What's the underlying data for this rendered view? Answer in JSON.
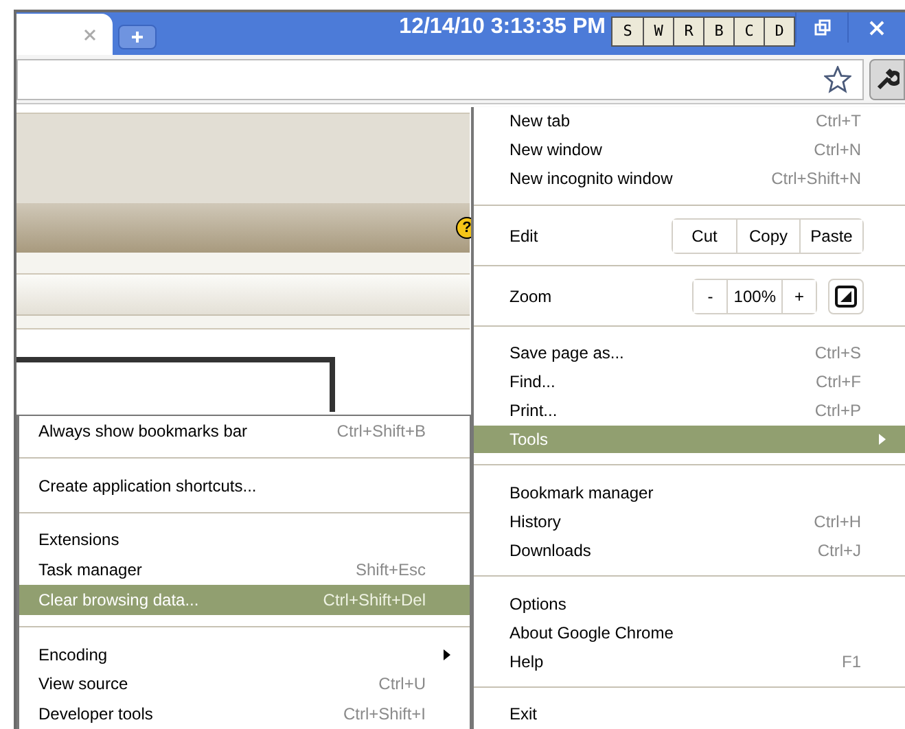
{
  "title_bar": {
    "clock": "12/14/10 3:13:35 PM",
    "buttons": [
      "S",
      "W",
      "R",
      "B",
      "C",
      "D"
    ]
  },
  "page": {
    "help_badge": "?"
  },
  "main_menu": {
    "items": [
      {
        "kind": "item",
        "label": "New tab",
        "shortcut": "Ctrl+T",
        "selected": false,
        "submenu": false
      },
      {
        "kind": "item",
        "label": "New window",
        "shortcut": "Ctrl+N",
        "selected": false,
        "submenu": false
      },
      {
        "kind": "item",
        "label": "New incognito window",
        "shortcut": "Ctrl+Shift+N",
        "selected": false,
        "submenu": false
      },
      {
        "kind": "separator"
      },
      {
        "kind": "edit",
        "label": "Edit",
        "buttons": [
          "Cut",
          "Copy",
          "Paste"
        ]
      },
      {
        "kind": "separator"
      },
      {
        "kind": "zoom",
        "label": "Zoom",
        "minus": "-",
        "value": "100%",
        "plus": "+"
      },
      {
        "kind": "separator"
      },
      {
        "kind": "item",
        "label": "Save page as...",
        "shortcut": "Ctrl+S",
        "selected": false,
        "submenu": false
      },
      {
        "kind": "item",
        "label": "Find...",
        "shortcut": "Ctrl+F",
        "selected": false,
        "submenu": false
      },
      {
        "kind": "item",
        "label": "Print...",
        "shortcut": "Ctrl+P",
        "selected": false,
        "submenu": false
      },
      {
        "kind": "item",
        "label": "Tools",
        "selected": true,
        "submenu": true
      },
      {
        "kind": "separator"
      },
      {
        "kind": "item",
        "label": "Bookmark manager",
        "selected": false,
        "submenu": false
      },
      {
        "kind": "item",
        "label": "History",
        "shortcut": "Ctrl+H",
        "selected": false,
        "submenu": false
      },
      {
        "kind": "item",
        "label": "Downloads",
        "shortcut": "Ctrl+J",
        "selected": false,
        "submenu": false
      },
      {
        "kind": "separator"
      },
      {
        "kind": "item",
        "label": "Options",
        "selected": false,
        "submenu": false
      },
      {
        "kind": "item",
        "label": "About Google Chrome",
        "selected": false,
        "submenu": false
      },
      {
        "kind": "item",
        "label": "Help",
        "shortcut": "F1",
        "selected": false,
        "submenu": false
      },
      {
        "kind": "separator"
      },
      {
        "kind": "item",
        "label": "Exit",
        "selected": false,
        "submenu": false
      }
    ]
  },
  "tools_submenu": {
    "items": [
      {
        "kind": "item",
        "label": "Always show bookmarks bar",
        "shortcut": "Ctrl+Shift+B",
        "selected": false,
        "submenu": false
      },
      {
        "kind": "separator"
      },
      {
        "kind": "item",
        "label": "Create application shortcuts...",
        "selected": false,
        "submenu": false
      },
      {
        "kind": "separator"
      },
      {
        "kind": "item",
        "label": "Extensions",
        "selected": false,
        "submenu": false
      },
      {
        "kind": "item",
        "label": "Task manager",
        "shortcut": "Shift+Esc",
        "selected": false,
        "submenu": false
      },
      {
        "kind": "item",
        "label": "Clear browsing data...",
        "shortcut": "Ctrl+Shift+Del",
        "selected": true,
        "submenu": false
      },
      {
        "kind": "separator"
      },
      {
        "kind": "item",
        "label": "Encoding",
        "selected": false,
        "submenu": true
      },
      {
        "kind": "item",
        "label": "View source",
        "shortcut": "Ctrl+U",
        "selected": false,
        "submenu": false
      },
      {
        "kind": "item",
        "label": "Developer tools",
        "shortcut": "Ctrl+Shift+I",
        "selected": false,
        "submenu": false
      }
    ]
  }
}
